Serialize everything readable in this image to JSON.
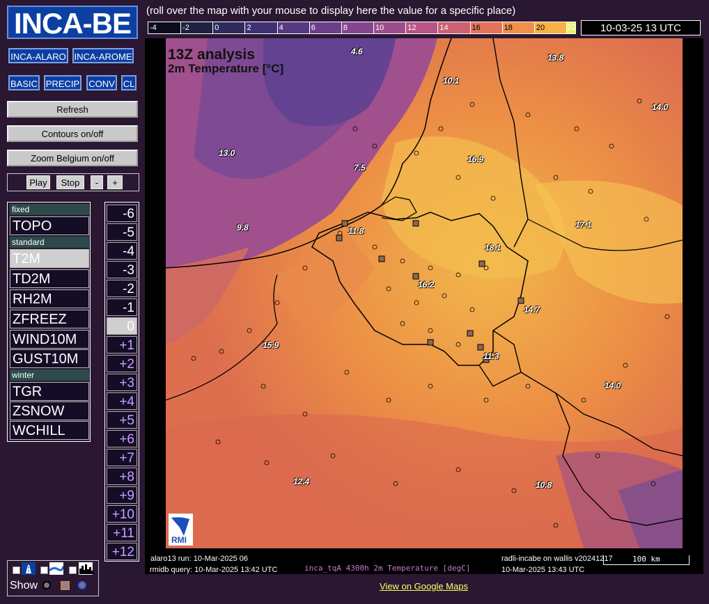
{
  "app": {
    "logo": "INCA-BE",
    "header_hint": "(roll over the map with your mouse to display here the value for a specific place)",
    "timestamp": "10-03-25 13 UTC"
  },
  "model_buttons": [
    "INCA-ALARO",
    "INCA-AROME"
  ],
  "category_buttons": [
    "BASIC",
    "PRECIP",
    "CONV",
    "CL"
  ],
  "actions": {
    "refresh": "Refresh",
    "contours": "Contours on/off",
    "zoom": "Zoom Belgium on/off"
  },
  "playbar": {
    "play": "Play",
    "stop": "Stop",
    "minus": "-",
    "plus": "+"
  },
  "params": {
    "group_fixed": "fixed",
    "group_standard": "standard",
    "group_winter": "winter",
    "fixed": [
      "TOPO"
    ],
    "standard": [
      "T2M",
      "TD2M",
      "RH2M",
      "ZFREEZ",
      "WIND10M",
      "GUST10M"
    ],
    "winter": [
      "TGR",
      "ZSNOW",
      "WCHILL"
    ],
    "selected": "T2M"
  },
  "hours": [
    "-6",
    "-5",
    "-4",
    "-3",
    "-2",
    "-1",
    "0",
    "+1",
    "+2",
    "+3",
    "+4",
    "+5",
    "+6",
    "+7",
    "+8",
    "+9",
    "+10",
    "+11",
    "+12"
  ],
  "selected_hour": "0",
  "colorscale": {
    "ticks": [
      "-4",
      "-2",
      "0",
      "2",
      "4",
      "6",
      "8",
      "10",
      "12",
      "14",
      "16",
      "18",
      "20"
    ],
    "max": "22",
    "colors": [
      "#0b0d1c",
      "#1e2140",
      "#2f2b5c",
      "#3f3173",
      "#563983",
      "#6c3f8b",
      "#84468f",
      "#9c4d8d",
      "#b75584",
      "#cd6071",
      "#e2735a",
      "#f0904a",
      "#f6b245"
    ]
  },
  "map": {
    "title1": "13Z analysis",
    "title2": "2m Temperature [°C]",
    "labels": [
      {
        "t": "4.6"
      },
      {
        "t": "13.8"
      },
      {
        "t": "10.1"
      },
      {
        "t": "14.0"
      },
      {
        "t": "13.0"
      },
      {
        "t": "16.9"
      },
      {
        "t": "7.5"
      },
      {
        "t": "9.8"
      },
      {
        "t": "11.8"
      },
      {
        "t": "17.1"
      },
      {
        "t": "18.1"
      },
      {
        "t": "16.2"
      },
      {
        "t": "14.7"
      },
      {
        "t": "15.9"
      },
      {
        "t": "11.3"
      },
      {
        "t": "14.0"
      },
      {
        "t": "12.4"
      },
      {
        "t": "10.8"
      }
    ],
    "logo_text": "RMI"
  },
  "footer": {
    "run": "alaro13 run: 10-Mar-2025 06",
    "query": "rmidb query: 10-Mar-2025 13:42 UTC",
    "field": "inca_tqA 4300h 2m Temperature [degC]",
    "server": "radli-incabe on wallis v20241217",
    "server_time": "10-Mar-2025 13:43 UTC",
    "km": "100 km"
  },
  "google_link": "View on Google Maps",
  "layers": {
    "show": "Show"
  }
}
